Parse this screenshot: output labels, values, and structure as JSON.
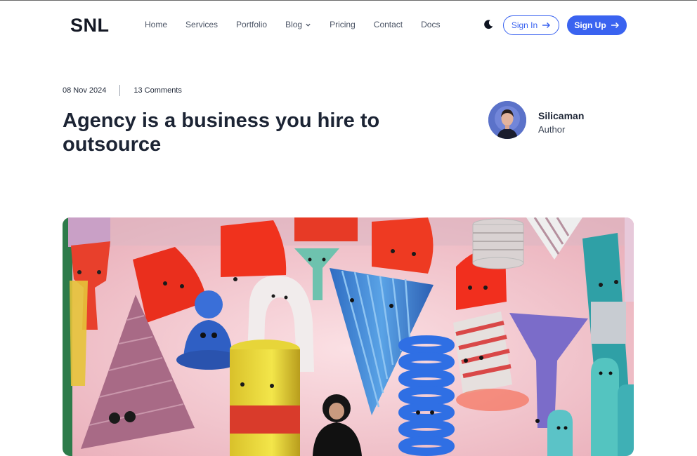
{
  "header": {
    "logo": "SNL",
    "nav": [
      {
        "label": "Home"
      },
      {
        "label": "Services"
      },
      {
        "label": "Portfolio"
      },
      {
        "label": "Blog",
        "has_dropdown": true
      },
      {
        "label": "Pricing"
      },
      {
        "label": "Contact"
      },
      {
        "label": "Docs"
      }
    ],
    "theme_icon": "moon-icon",
    "sign_in_label": "Sign In",
    "sign_up_label": "Sign Up"
  },
  "post": {
    "date": "08 Nov 2024",
    "comments": "13 Comments",
    "title": "Agency is a business you hire to outsource",
    "author": {
      "name": "Silicaman",
      "role": "Author"
    }
  },
  "colors": {
    "accent": "#3a63f0",
    "text": "#1c2434"
  }
}
